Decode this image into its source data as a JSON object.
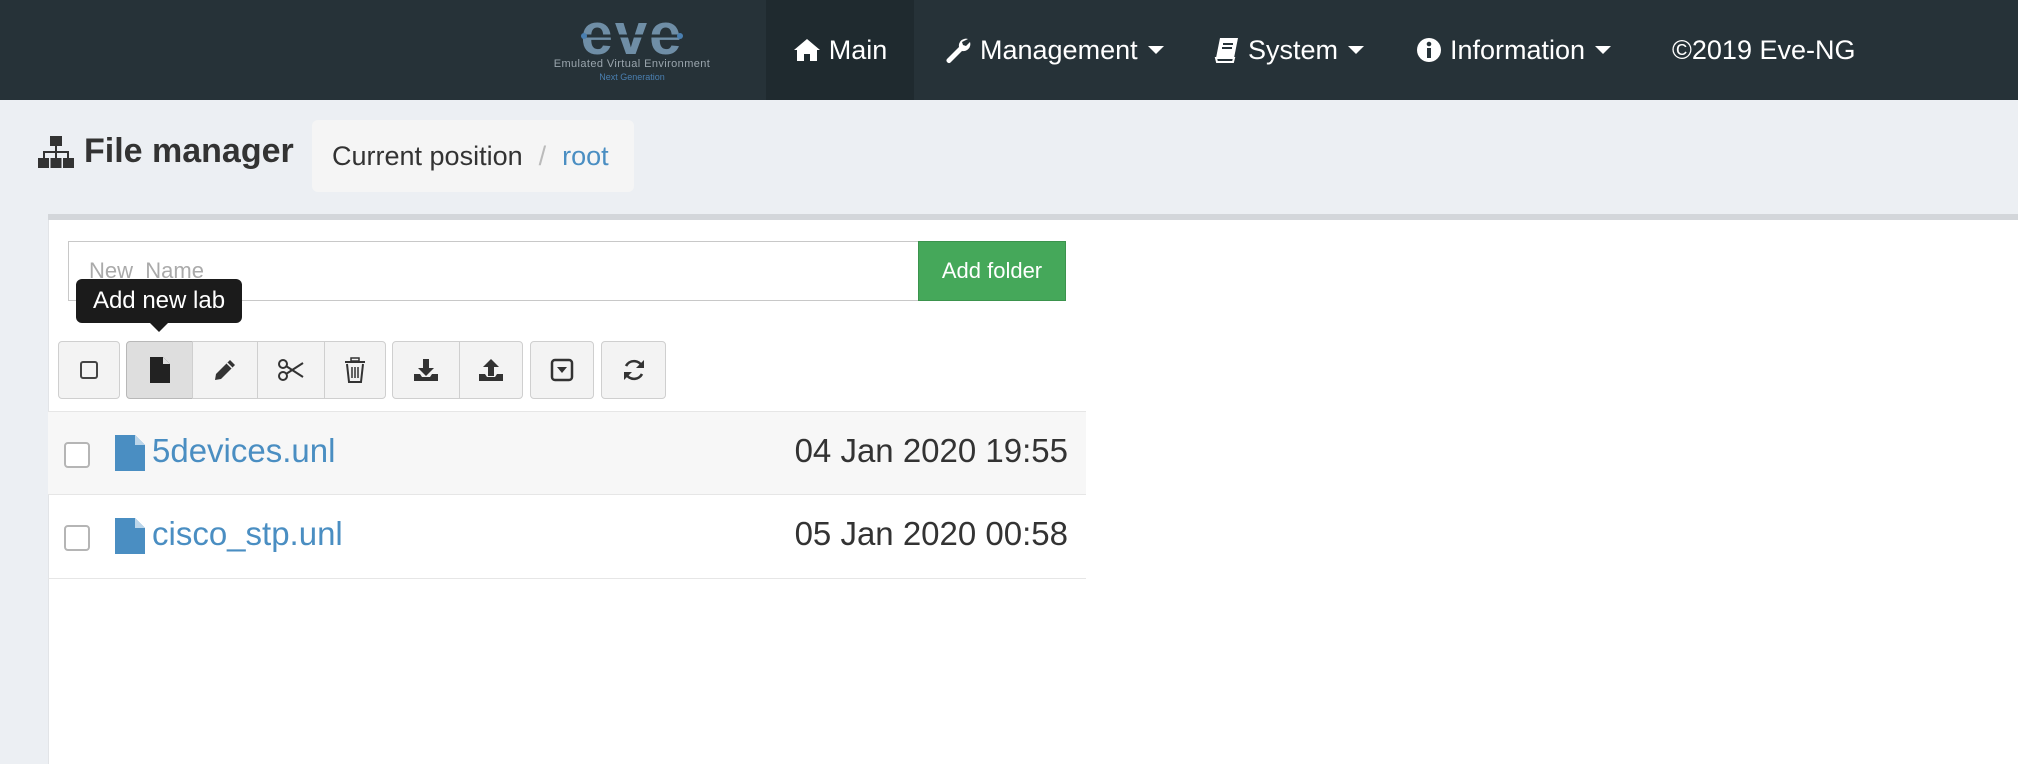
{
  "navbar": {
    "logo_text": "eve",
    "logo_subtitle": "Emulated Virtual Environment",
    "logo_tagline": "Next Generation",
    "items": [
      {
        "label": "Main",
        "icon": "home-icon",
        "active": true,
        "dropdown": false
      },
      {
        "label": "Management",
        "icon": "wrench-icon",
        "active": false,
        "dropdown": true
      },
      {
        "label": "System",
        "icon": "book-icon",
        "active": false,
        "dropdown": true
      },
      {
        "label": "Information",
        "icon": "info-icon",
        "active": false,
        "dropdown": true
      }
    ],
    "copyright": "©2019 Eve-NG"
  },
  "page": {
    "title": "File manager",
    "title_icon": "sitemap-icon",
    "breadcrumb": {
      "static": "Current position",
      "separator": "/",
      "link": "root"
    }
  },
  "folder_form": {
    "placeholder": "New_Name",
    "value": "",
    "button_label": "Add folder"
  },
  "toolbar": {
    "tooltip": "Add new lab",
    "buttons": [
      {
        "name": "select-all",
        "icon": "checkbox-icon"
      },
      {
        "name": "add-lab",
        "icon": "file-icon"
      },
      {
        "name": "rename",
        "icon": "pencil-icon"
      },
      {
        "name": "move",
        "icon": "scissors-icon"
      },
      {
        "name": "delete",
        "icon": "trash-icon"
      },
      {
        "name": "import",
        "icon": "download-icon"
      },
      {
        "name": "export",
        "icon": "upload-icon"
      },
      {
        "name": "open-dropdown",
        "icon": "caret-square-down-icon"
      },
      {
        "name": "refresh",
        "icon": "refresh-icon"
      }
    ]
  },
  "files": [
    {
      "name": "5devices.unl",
      "date": "04 Jan 2020 19:55",
      "icon": "file-icon"
    },
    {
      "name": "cisco_stp.unl",
      "date": "05 Jan 2020 00:58",
      "icon": "file-icon"
    }
  ],
  "colors": {
    "navbar_bg": "#263238",
    "link": "#4a8ec2",
    "add_folder_bg": "#45a85a",
    "page_bg": "#eceff3"
  }
}
